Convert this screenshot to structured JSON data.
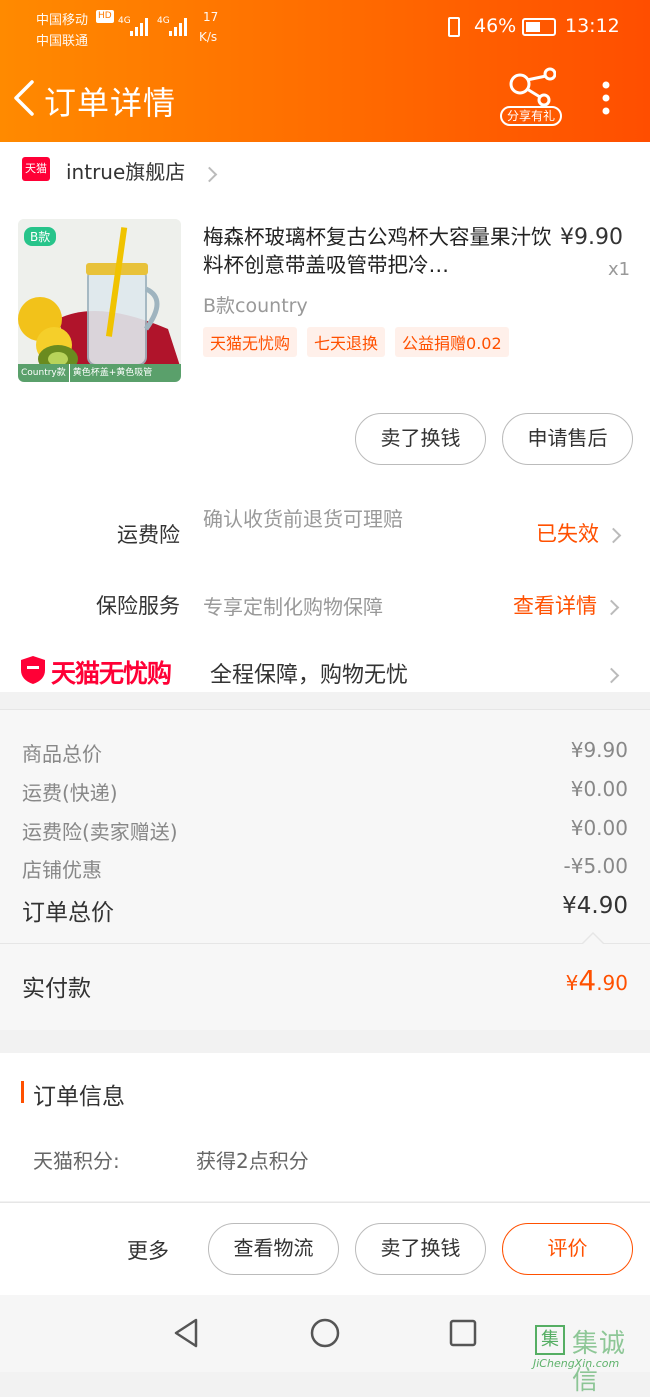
{
  "status_bar": {
    "carrier1": "中国移动",
    "carrier2": "中国联通",
    "hd": "HD",
    "net1": "4G",
    "net2": "4G",
    "speed_value": "17",
    "speed_unit": "K/s",
    "battery": "46%",
    "time": "13:12"
  },
  "header": {
    "title": "订单详情",
    "share_label": "分享有礼"
  },
  "store": {
    "badge": "天猫",
    "name": "intrue旗舰店"
  },
  "product": {
    "image_tag": "B款",
    "image_caption_left": "Country款",
    "image_caption_right": "黄色杯盖+黄色吸管",
    "title": "梅森杯玻璃杯复古公鸡杯大容量果汁饮料杯创意带盖吸管带把冷…",
    "price": "¥9.90",
    "qty": "x1",
    "sku": "B款country",
    "tags": [
      "天猫无忧购",
      "七天退换",
      "公益捐赠0.02"
    ]
  },
  "actions": {
    "sell": "卖了换钱",
    "after_sale": "申请售后"
  },
  "insurance": {
    "freight_label": "运费险",
    "freight_desc": "确认收货前退货可理赔",
    "freight_status": "已失效",
    "service_label": "保险服务",
    "service_desc": "专享定制化购物保障",
    "service_link": "查看详情"
  },
  "worry_free": {
    "logo": "天猫无忧购",
    "text": "全程保障，购物无忧"
  },
  "summary": {
    "rows": [
      {
        "label": "商品总价",
        "value": "¥9.90"
      },
      {
        "label": "运费(快递)",
        "value": "¥0.00"
      },
      {
        "label": "运费险(卖家赠送)",
        "value": "¥0.00"
      },
      {
        "label": "店铺优惠",
        "value": "-¥5.00"
      }
    ],
    "total_label": "订单总价",
    "total_value": "¥4.90",
    "paid_label": "实付款",
    "paid_symbol": "¥",
    "paid_int": "4",
    "paid_dec": ".90"
  },
  "order_info": {
    "title": "订单信息",
    "points_label": "天猫积分:",
    "points_value": "获得2点积分"
  },
  "bottom_bar": {
    "more": "更多",
    "logistics": "查看物流",
    "sell": "卖了换钱",
    "review": "评价"
  },
  "watermark": {
    "cn": "集诚信",
    "en": "JiChengXin.com"
  }
}
